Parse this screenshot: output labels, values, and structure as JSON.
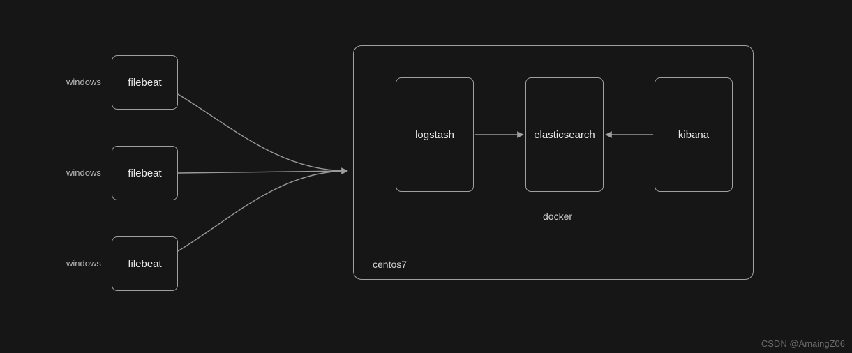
{
  "nodes": {
    "filebeat1": {
      "label": "filebeat",
      "side_label": "windows"
    },
    "filebeat2": {
      "label": "filebeat",
      "side_label": "windows"
    },
    "filebeat3": {
      "label": "filebeat",
      "side_label": "windows"
    },
    "logstash": {
      "label": "logstash"
    },
    "elasticsearch": {
      "label": "elasticsearch"
    },
    "kibana": {
      "label": "kibana"
    }
  },
  "containers": {
    "centos7": {
      "label": "centos7"
    },
    "docker": {
      "label": "docker"
    }
  },
  "edges": [
    {
      "from": "filebeat1",
      "to": "centos7_left"
    },
    {
      "from": "filebeat2",
      "to": "centos7_left"
    },
    {
      "from": "filebeat3",
      "to": "centos7_left"
    },
    {
      "from": "logstash",
      "to": "elasticsearch"
    },
    {
      "from": "kibana",
      "to": "elasticsearch"
    }
  ],
  "watermark": "CSDN @AmaingZ06"
}
